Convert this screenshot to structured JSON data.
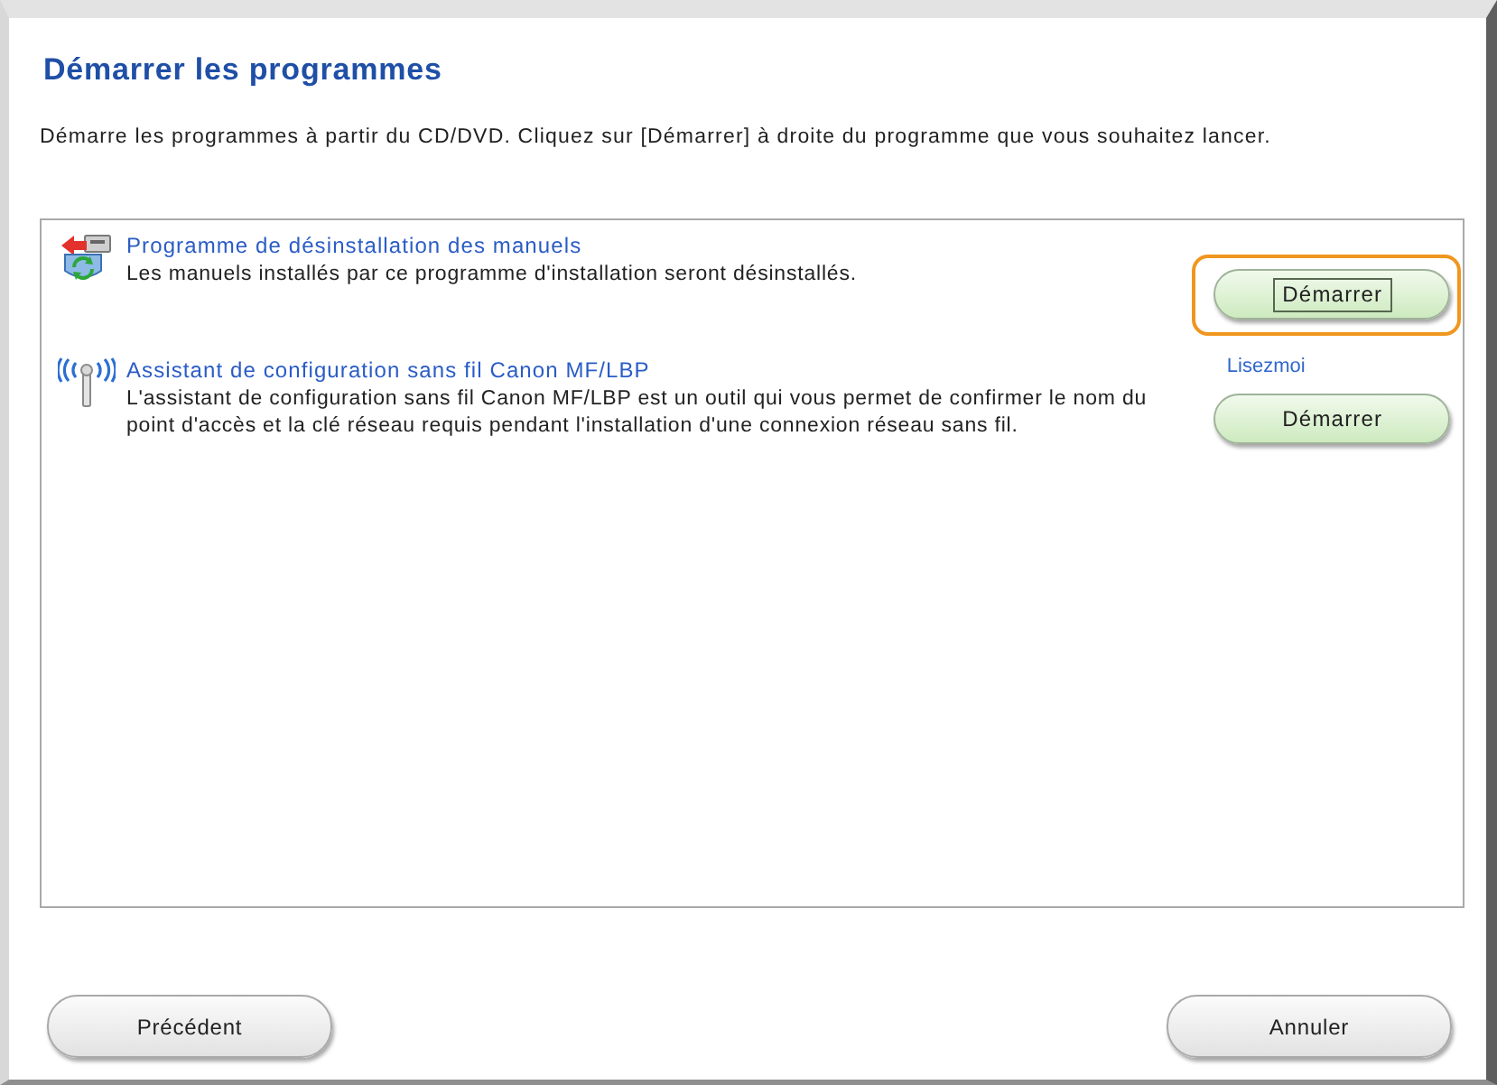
{
  "page": {
    "title": "Démarrer les programmes",
    "instructions": "Démarre les programmes à partir du CD/DVD. Cliquez sur [Démarrer] à droite du programme que vous souhaitez lancer."
  },
  "programs": [
    {
      "kind": "uninstaller",
      "title": "Programme de désinstallation des manuels",
      "description": "Les manuels installés par ce programme d'installation seront désinstallés.",
      "button": {
        "label": "Démarrer",
        "focused": true,
        "highlighted": true
      }
    },
    {
      "kind": "wireless",
      "title": "Assistant de configuration sans fil Canon MF/LBP",
      "description": "L'assistant de configuration sans fil Canon MF/LBP est un outil qui vous permet de confirmer le nom du point d'accès et la clé réseau requis pendant l'installation d'une connexion réseau sans fil.",
      "readme": "Lisezmoi",
      "button": {
        "label": "Démarrer",
        "focused": false,
        "highlighted": false
      }
    }
  ],
  "footer": {
    "buttons": [
      {
        "label": "Précédent"
      },
      {
        "label": "Annuler"
      }
    ]
  }
}
